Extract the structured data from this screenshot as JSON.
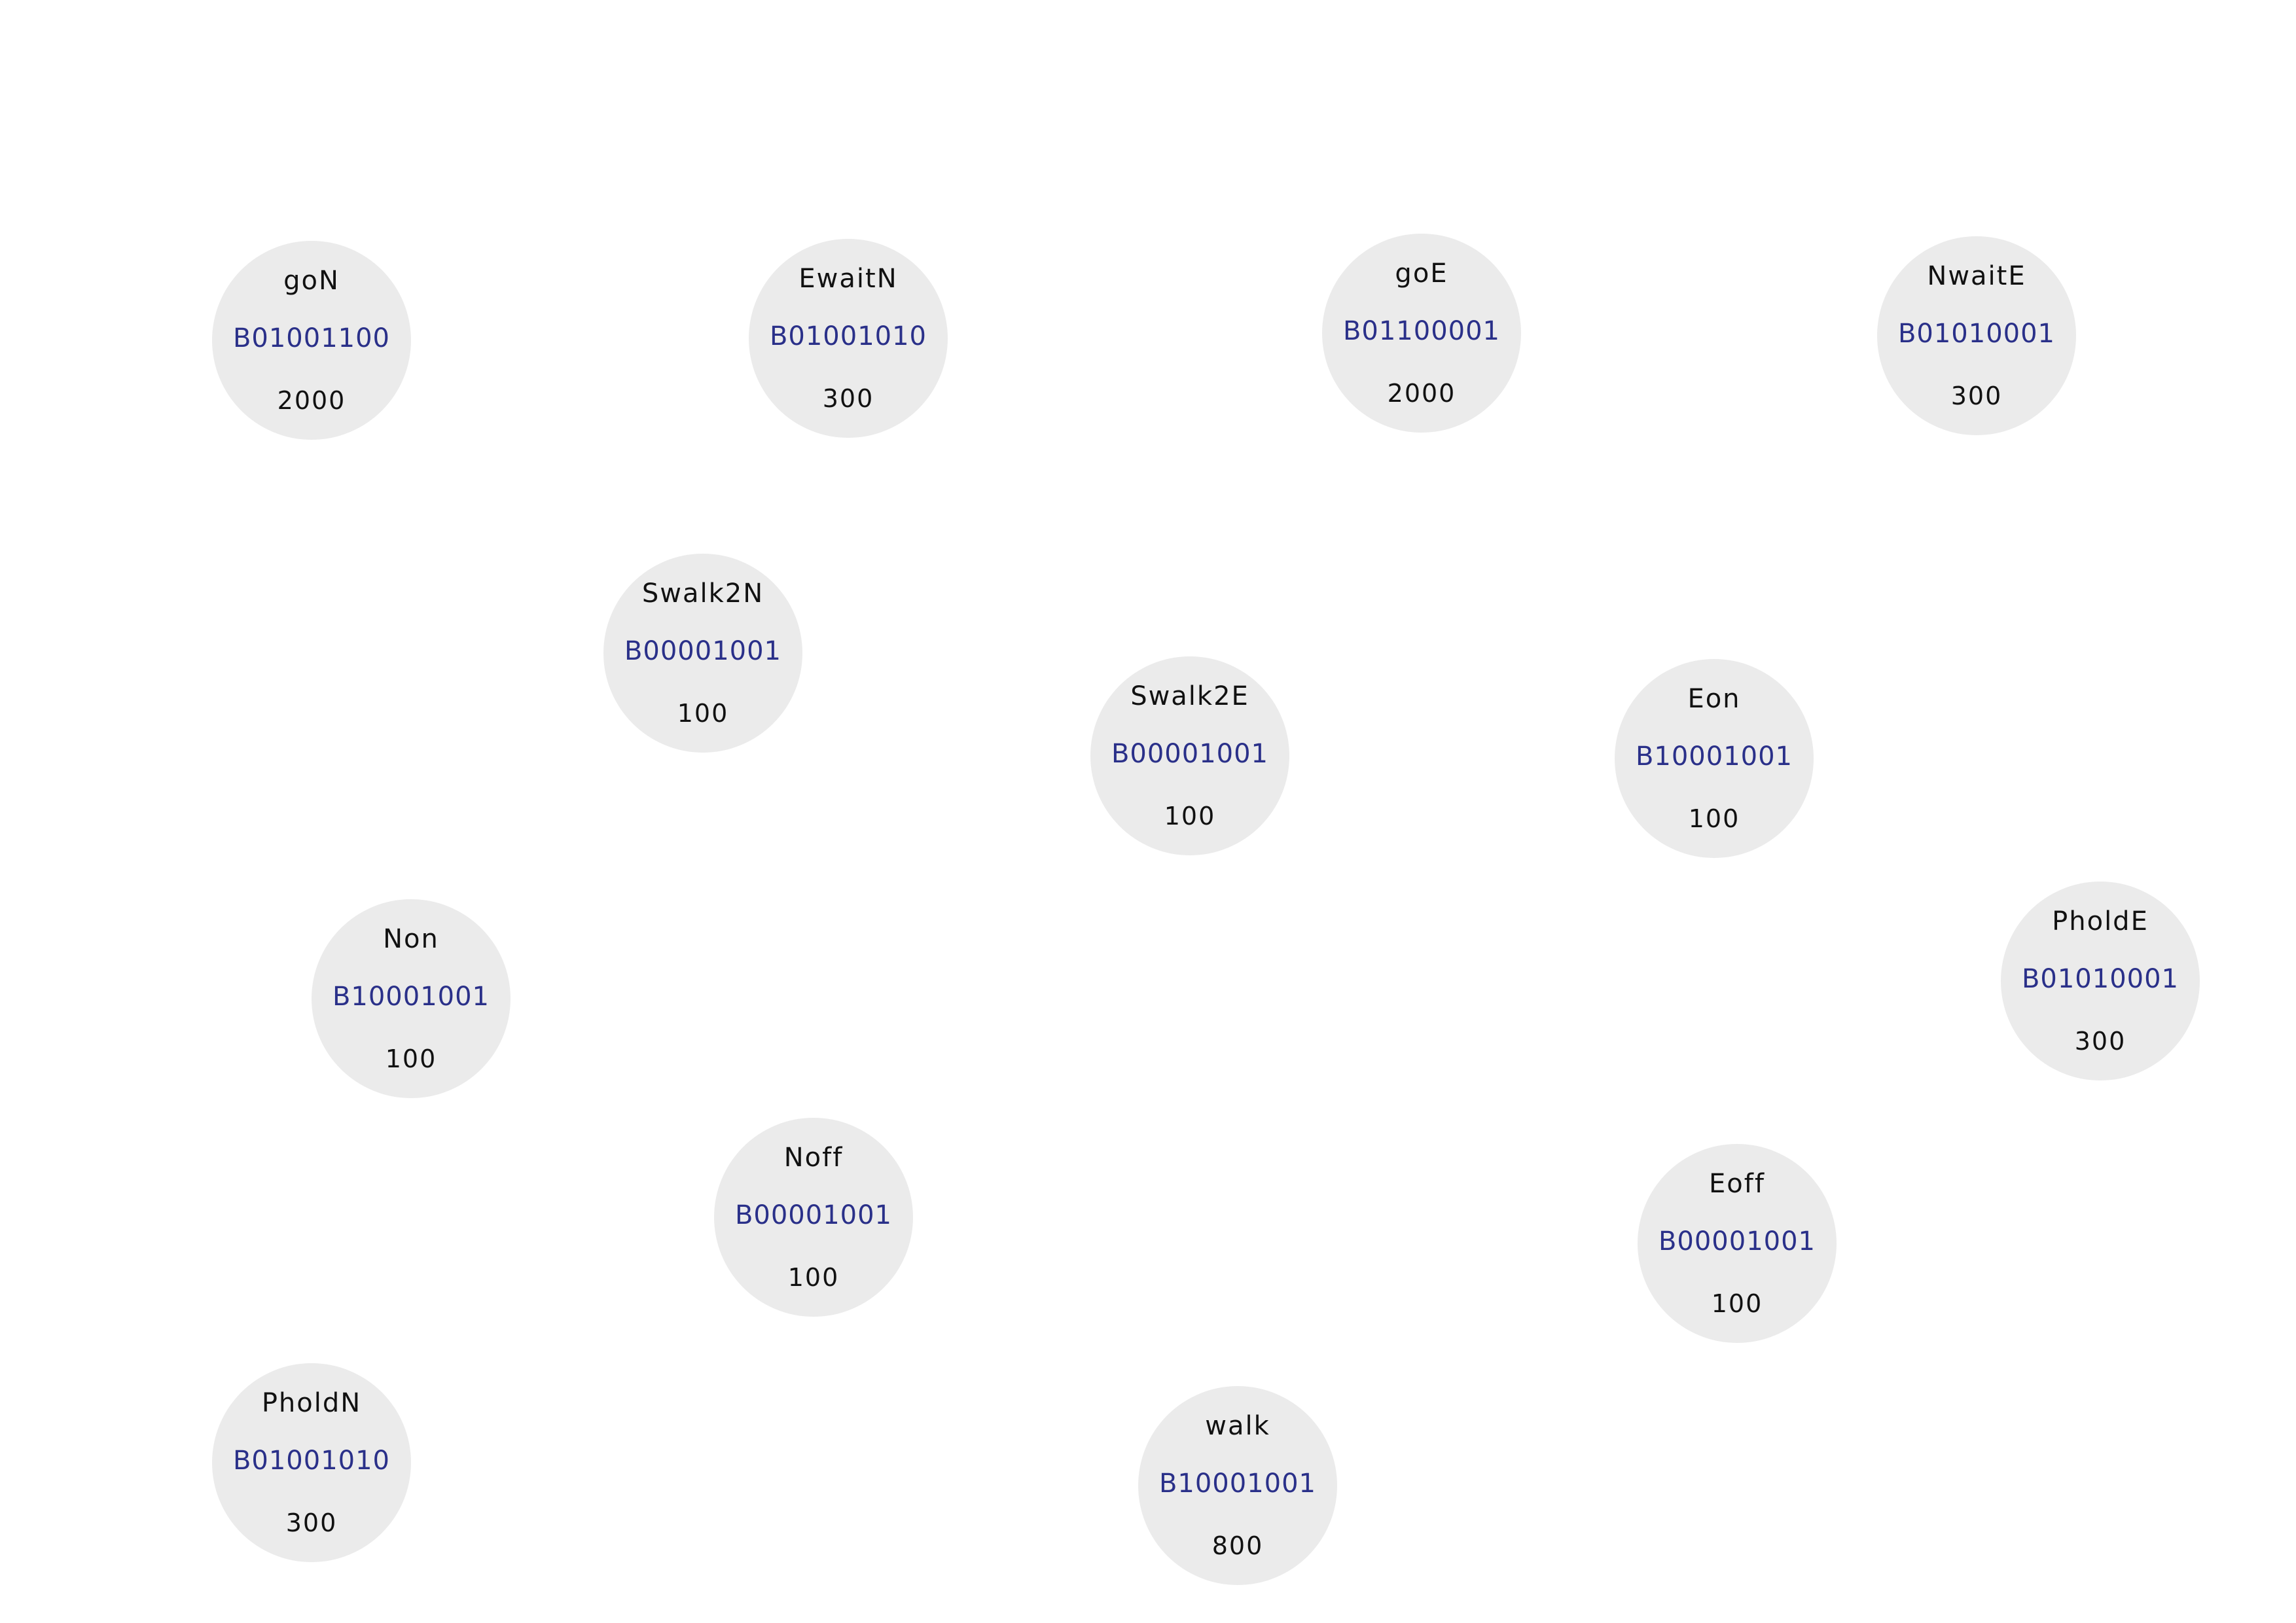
{
  "colors": {
    "background": "#ffffff",
    "node_fill": "#ebebeb",
    "name_text": "#111111",
    "code_text": "#2a3089",
    "duration_text": "#111111"
  },
  "states": [
    {
      "id": "goN",
      "name": "goN",
      "code": "B01001100",
      "duration": "2000"
    },
    {
      "id": "EwaitN",
      "name": "EwaitN",
      "code": "B01001010",
      "duration": "300"
    },
    {
      "id": "goE",
      "name": "goE",
      "code": "B01100001",
      "duration": "2000"
    },
    {
      "id": "NwaitE",
      "name": "NwaitE",
      "code": "B01010001",
      "duration": "300"
    },
    {
      "id": "Swalk2N",
      "name": "Swalk2N",
      "code": "B00001001",
      "duration": "100"
    },
    {
      "id": "Swalk2E",
      "name": "Swalk2E",
      "code": "B00001001",
      "duration": "100"
    },
    {
      "id": "Eon",
      "name": "Eon",
      "code": "B10001001",
      "duration": "100"
    },
    {
      "id": "PholdE",
      "name": "PholdE",
      "code": "B01010001",
      "duration": "300"
    },
    {
      "id": "Non",
      "name": "Non",
      "code": "B10001001",
      "duration": "100"
    },
    {
      "id": "Noff",
      "name": "Noff",
      "code": "B00001001",
      "duration": "100"
    },
    {
      "id": "Eoff",
      "name": "Eoff",
      "code": "B00001001",
      "duration": "100"
    },
    {
      "id": "PholdN",
      "name": "PholdN",
      "code": "B01001010",
      "duration": "300"
    },
    {
      "id": "walk",
      "name": "walk",
      "code": "B10001001",
      "duration": "800"
    }
  ]
}
